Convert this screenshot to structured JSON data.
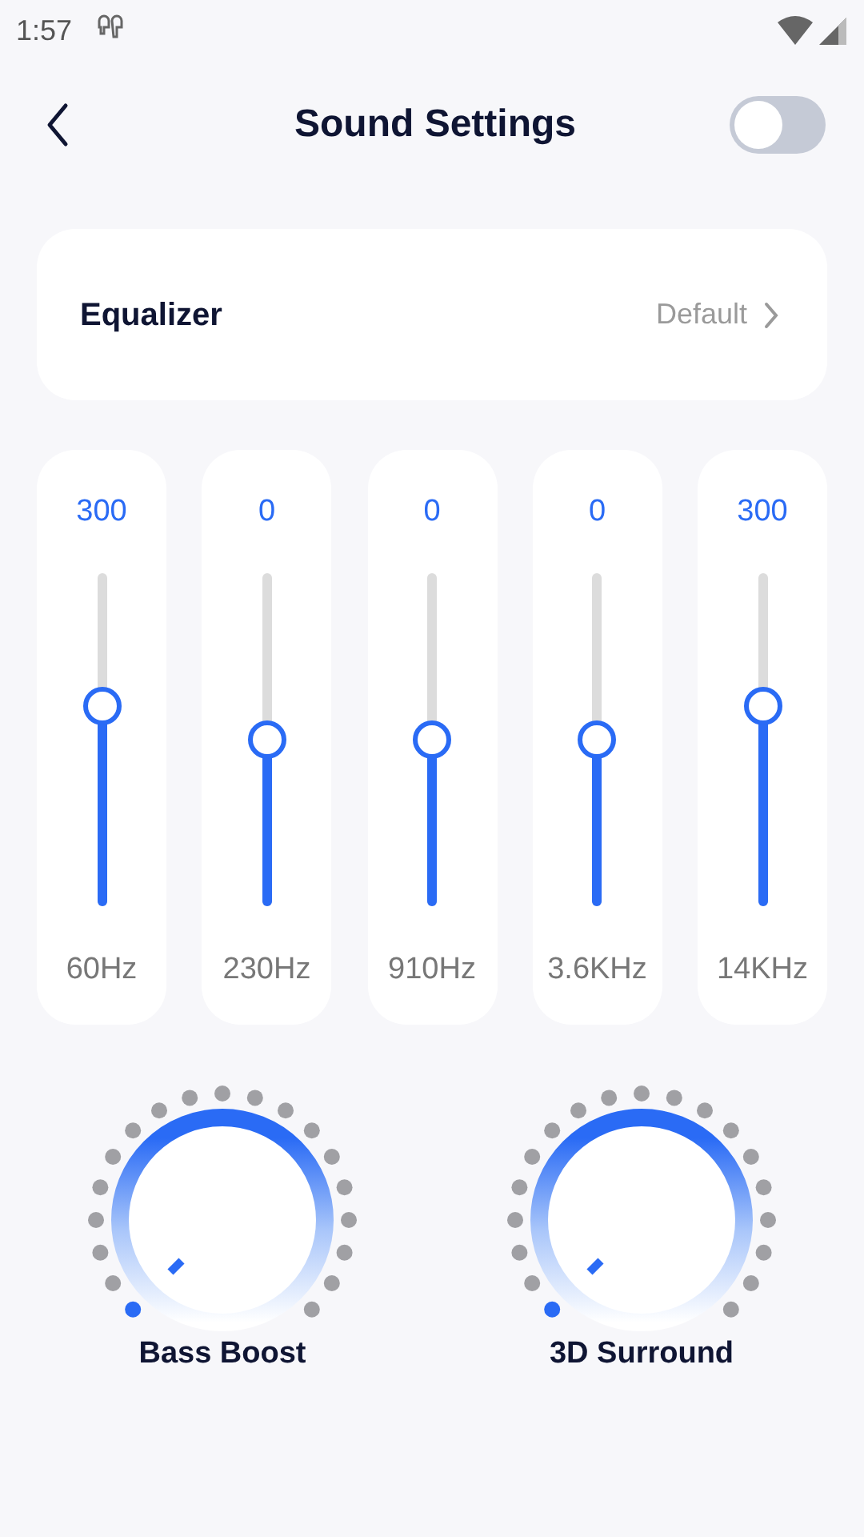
{
  "status_bar": {
    "time": "1:57"
  },
  "header": {
    "title": "Sound Settings",
    "toggle": {
      "on": false
    }
  },
  "equalizer": {
    "label": "Equalizer",
    "preset": "Default"
  },
  "bands": [
    {
      "value": "300",
      "frequency": "60Hz",
      "level": 0.6
    },
    {
      "value": "0",
      "frequency": "230Hz",
      "level": 0.5
    },
    {
      "value": "0",
      "frequency": "910Hz",
      "level": 0.5
    },
    {
      "value": "0",
      "frequency": "3.6KHz",
      "level": 0.5
    },
    {
      "value": "300",
      "frequency": "14KHz",
      "level": 0.6
    }
  ],
  "knobs": [
    {
      "label": "Bass Boost"
    },
    {
      "label": "3D Surround"
    }
  ]
}
